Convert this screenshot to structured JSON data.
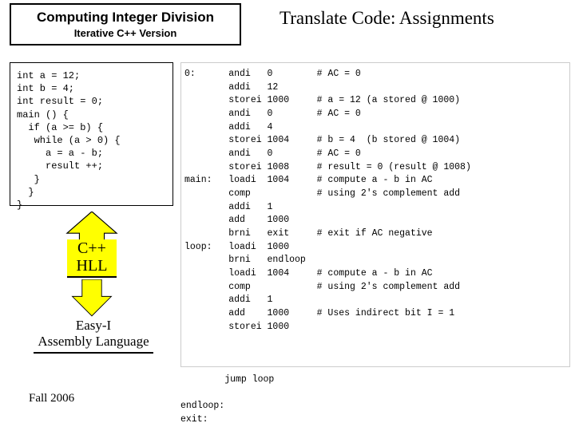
{
  "header": {
    "title": "Computing Integer Division",
    "subtitle": "Iterative C++ Version"
  },
  "main_title": "Translate Code: Assignments",
  "cpp_code": "int a = 12;\nint b = 4;\nint result = 0;\nmain () {\n  if (a >= b) {\n   while (a > 0) {\n     a = a - b;\n     result ++;\n   }\n  }\n}",
  "asm_code": "0:      andi   0        # AC = 0\n        addi   12\n        storei 1000     # a = 12 (a stored @ 1000)\n        andi   0        # AC = 0\n        addi   4\n        storei 1004     # b = 4  (b stored @ 1004)\n        andi   0        # AC = 0\n        storei 1008     # result = 0 (result @ 1008)\nmain:   loadi  1004     # compute a - b in AC\n        comp            # using 2's complement add\n        addi   1\n        add    1000\n        brni   exit     # exit if AC negative\nloop:   loadi  1000\n        brni   endloop\n        loadi  1004     # compute a - b in AC\n        comp            # using 2's complement add\n        addi   1\n        add    1000     # Uses indirect bit I = 1\n        storei 1000",
  "asm_footer": "        jump loop\n\nendloop:\nexit:",
  "labels": {
    "cpp": "C++\nHLL",
    "easy": "Easy-I\nAssembly Language"
  },
  "footer": "Fall 2006",
  "colors": {
    "arrow_fill": "#ffff00",
    "arrow_stroke": "#000000"
  }
}
